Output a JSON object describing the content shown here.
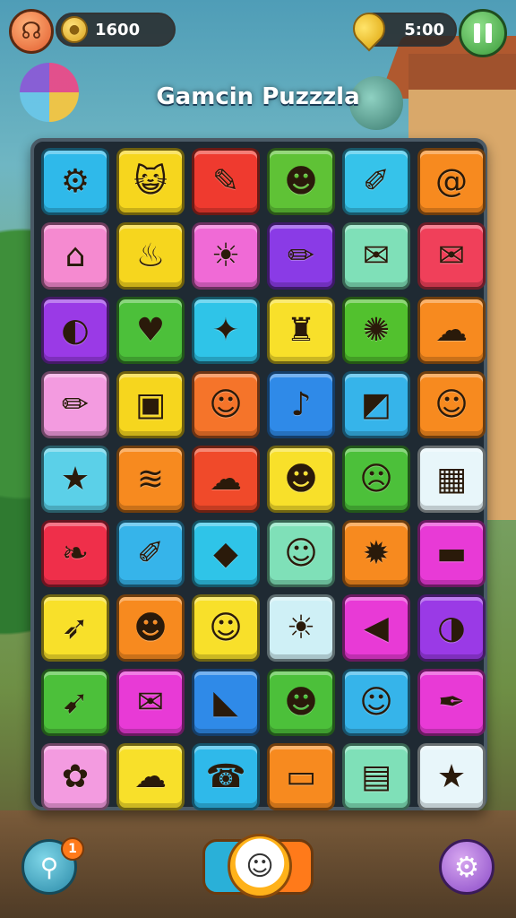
{
  "hud": {
    "coins": "1600",
    "timer": "5:00"
  },
  "title": "Gamcin Puzzzla",
  "hint_badge": "1",
  "tiles": [
    {
      "name": "gear-tile",
      "icon": "gear-icon",
      "glyph": "⚙",
      "color": "#2fb9ea"
    },
    {
      "name": "cat-face-tile",
      "icon": "cat-face-icon",
      "glyph": "😺",
      "color": "#f6d61e"
    },
    {
      "name": "pencil-tile",
      "icon": "pencil-icon",
      "glyph": "✎",
      "color": "#ef3a2f"
    },
    {
      "name": "blob-face-tile",
      "icon": "blob-face-icon",
      "glyph": "☻",
      "color": "#5fc236"
    },
    {
      "name": "carrot-tile",
      "icon": "carrot-icon",
      "glyph": "✐",
      "color": "#36c3ea"
    },
    {
      "name": "swirl-tile",
      "icon": "swirl-icon",
      "glyph": "@",
      "color": "#f78a1f"
    },
    {
      "name": "house-box-tile",
      "icon": "house-box-icon",
      "glyph": "⌂",
      "color": "#f58ad0"
    },
    {
      "name": "flame-tile",
      "icon": "flame-icon",
      "glyph": "♨",
      "color": "#f6d61e"
    },
    {
      "name": "sun-tile",
      "icon": "sun-icon",
      "glyph": "☀",
      "color": "#f06ad6"
    },
    {
      "name": "pencil-tile",
      "icon": "pencil-icon",
      "glyph": "✏",
      "color": "#8a3be6"
    },
    {
      "name": "envelope-tile",
      "icon": "envelope-icon",
      "glyph": "✉",
      "color": "#7fe0b8"
    },
    {
      "name": "mail-tile",
      "icon": "mail-icon",
      "glyph": "✉",
      "color": "#f0405a"
    },
    {
      "name": "ball-tile",
      "icon": "ball-icon",
      "glyph": "◐",
      "color": "#9a3ae6"
    },
    {
      "name": "heart-tile",
      "icon": "heart-icon",
      "glyph": "♥",
      "color": "#4cc03a"
    },
    {
      "name": "star-badge-tile",
      "icon": "star-badge-icon",
      "glyph": "✦",
      "color": "#2fc4e8"
    },
    {
      "name": "bottles-tile",
      "icon": "bottles-icon",
      "glyph": "♜",
      "color": "#f8e02a"
    },
    {
      "name": "spiral-tile",
      "icon": "spiral-icon",
      "glyph": "✺",
      "color": "#52c12e"
    },
    {
      "name": "cloud-tile",
      "icon": "cloud-icon",
      "glyph": "☁",
      "color": "#f78a1f"
    },
    {
      "name": "pencil-tile",
      "icon": "pencil-icon",
      "glyph": "✏",
      "color": "#f39be0"
    },
    {
      "name": "device-tile",
      "icon": "device-icon",
      "glyph": "▣",
      "color": "#f6d61e"
    },
    {
      "name": "girl-face-tile",
      "icon": "girl-face-icon",
      "glyph": "☺",
      "color": "#f5742a"
    },
    {
      "name": "bell-tile",
      "icon": "bell-icon",
      "glyph": "♪",
      "color": "#2f8ae8"
    },
    {
      "name": "tablet-tile",
      "icon": "tablet-icon",
      "glyph": "◩",
      "color": "#36b4ea"
    },
    {
      "name": "smile-ball-tile",
      "icon": "smile-ball-icon",
      "glyph": "☺",
      "color": "#f78a1f"
    },
    {
      "name": "star-tile",
      "icon": "star-icon",
      "glyph": "★",
      "color": "#5bd0e8"
    },
    {
      "name": "cake-tile",
      "icon": "cake-icon",
      "glyph": "≋",
      "color": "#f78a1f"
    },
    {
      "name": "cloud-tile",
      "icon": "cloud-icon",
      "glyph": "☁",
      "color": "#f04a2a"
    },
    {
      "name": "gnome-face-tile",
      "icon": "gnome-face-icon",
      "glyph": "☻",
      "color": "#f8e02a"
    },
    {
      "name": "bubble-face-tile",
      "icon": "bubble-face-icon",
      "glyph": "☹",
      "color": "#4cc03a"
    },
    {
      "name": "calendar-tile",
      "icon": "calendar-icon",
      "glyph": "▦",
      "color": "#e8f6fa"
    },
    {
      "name": "leaf-tile",
      "icon": "leaf-icon",
      "glyph": "❧",
      "color": "#ef2f4a"
    },
    {
      "name": "crayon-tile",
      "icon": "crayon-icon",
      "glyph": "✐",
      "color": "#36b4ea"
    },
    {
      "name": "gem-tile",
      "icon": "gem-icon",
      "glyph": "◆",
      "color": "#2fc4e8"
    },
    {
      "name": "blob-face-tile",
      "icon": "blob-face-icon",
      "glyph": "☺",
      "color": "#7fe0b8"
    },
    {
      "name": "sun-gear-tile",
      "icon": "sun-gear-icon",
      "glyph": "✹",
      "color": "#f78a1f"
    },
    {
      "name": "toy-block-tile",
      "icon": "toy-block-icon",
      "glyph": "▬",
      "color": "#e83ad6"
    },
    {
      "name": "rocket-tile",
      "icon": "rocket-icon",
      "glyph": "➶",
      "color": "#f8e02a"
    },
    {
      "name": "cat-ball-tile",
      "icon": "cat-ball-icon",
      "glyph": "☻",
      "color": "#f78a1f"
    },
    {
      "name": "slime-tile",
      "icon": "slime-icon",
      "glyph": "☺",
      "color": "#f8e02a"
    },
    {
      "name": "sun-face-tile",
      "icon": "sun-face-icon",
      "glyph": "☀",
      "color": "#cff0f6"
    },
    {
      "name": "megaphone-tile",
      "icon": "megaphone-icon",
      "glyph": "◀",
      "color": "#e83ad6"
    },
    {
      "name": "beach-ball-tile",
      "icon": "beach-ball-icon",
      "glyph": "◑",
      "color": "#9a3ae6"
    },
    {
      "name": "arrow-tile",
      "icon": "arrow-icon",
      "glyph": "➹",
      "color": "#4cc03a"
    },
    {
      "name": "letter-tile",
      "icon": "letter-icon",
      "glyph": "✉",
      "color": "#e83ad6"
    },
    {
      "name": "kite-tile",
      "icon": "kite-icon",
      "glyph": "◣",
      "color": "#2f8ae8"
    },
    {
      "name": "monster-tile",
      "icon": "monster-icon",
      "glyph": "☻",
      "color": "#4cc03a"
    },
    {
      "name": "ghost-face-tile",
      "icon": "ghost-face-icon",
      "glyph": "☺",
      "color": "#36b4ea"
    },
    {
      "name": "pen-tile",
      "icon": "pen-icon",
      "glyph": "✒",
      "color": "#e83ad6"
    },
    {
      "name": "flower-gear-tile",
      "icon": "flower-gear-icon",
      "glyph": "✿",
      "color": "#f39be0"
    },
    {
      "name": "cloud-tile",
      "icon": "cloud-icon",
      "glyph": "☁",
      "color": "#f8e02a"
    },
    {
      "name": "phone-face-tile",
      "icon": "phone-face-icon",
      "glyph": "☎",
      "color": "#2fb9ea"
    },
    {
      "name": "card-tile",
      "icon": "card-icon",
      "glyph": "▭",
      "color": "#f78a1f"
    },
    {
      "name": "document-tile",
      "icon": "document-icon",
      "glyph": "▤",
      "color": "#7fe0b8"
    },
    {
      "name": "star-tile",
      "icon": "star-icon",
      "glyph": "★",
      "color": "#e8f6fa"
    }
  ]
}
